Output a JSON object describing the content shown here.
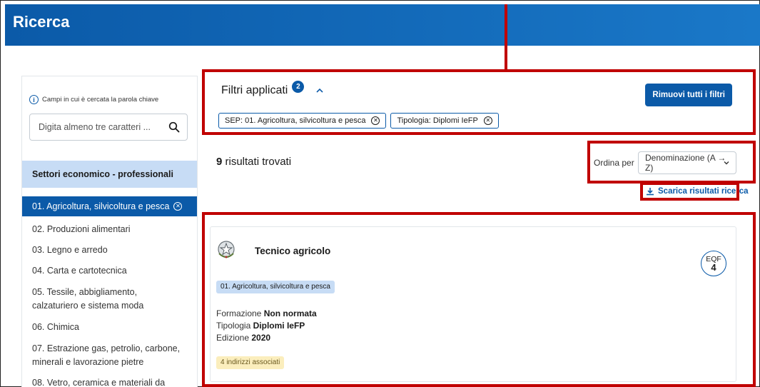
{
  "header": {
    "title": "Ricerca"
  },
  "sidebar": {
    "search_hint": "Campi in cui è cercata la parola chiave",
    "search_placeholder": "Digita almeno tre caratteri ...",
    "section_title": "Settori economico - professionali",
    "items": [
      "01. Agricoltura, silvicoltura e pesca",
      "02. Produzioni alimentari",
      "03. Legno e arredo",
      "04. Carta e cartotecnica",
      "05. Tessile, abbigliamento, calzaturiero e sistema moda",
      "06. Chimica",
      "07. Estrazione gas, petrolio, carbone, minerali e lavorazione pietre",
      "08. Vetro, ceramica e materiali da"
    ]
  },
  "filters": {
    "title": "Filtri applicati",
    "count": "2",
    "remove_all": "Rimuovi tutti i filtri",
    "chips": [
      "SEP: 01. Agricoltura, silvicoltura e pesca",
      "Tipologia: Diplomi IeFP"
    ]
  },
  "results": {
    "count": "9",
    "count_label": " risultati trovati",
    "sort_label": "Ordina per",
    "sort_value": "Denominazione (A → Z)",
    "download": "Scarica risultati ricerca"
  },
  "card": {
    "title": "Tecnico agricolo",
    "eqf_label": "EQF",
    "eqf_value": "4",
    "sector_tag": "01. Agricoltura, silvicoltura e pesca",
    "formazione_label": "Formazione",
    "formazione_value": "Non normata",
    "tipologia_label": "Tipologia",
    "tipologia_value": "Diplomi IeFP",
    "edizione_label": "Edizione",
    "edizione_value": "2020",
    "addresses": "4 indirizzi associati"
  },
  "colors": {
    "primary": "#0b5aa8",
    "highlight": "#c7dcf5",
    "annotation": "#c00000",
    "badge_yellow": "#fbeebd"
  }
}
